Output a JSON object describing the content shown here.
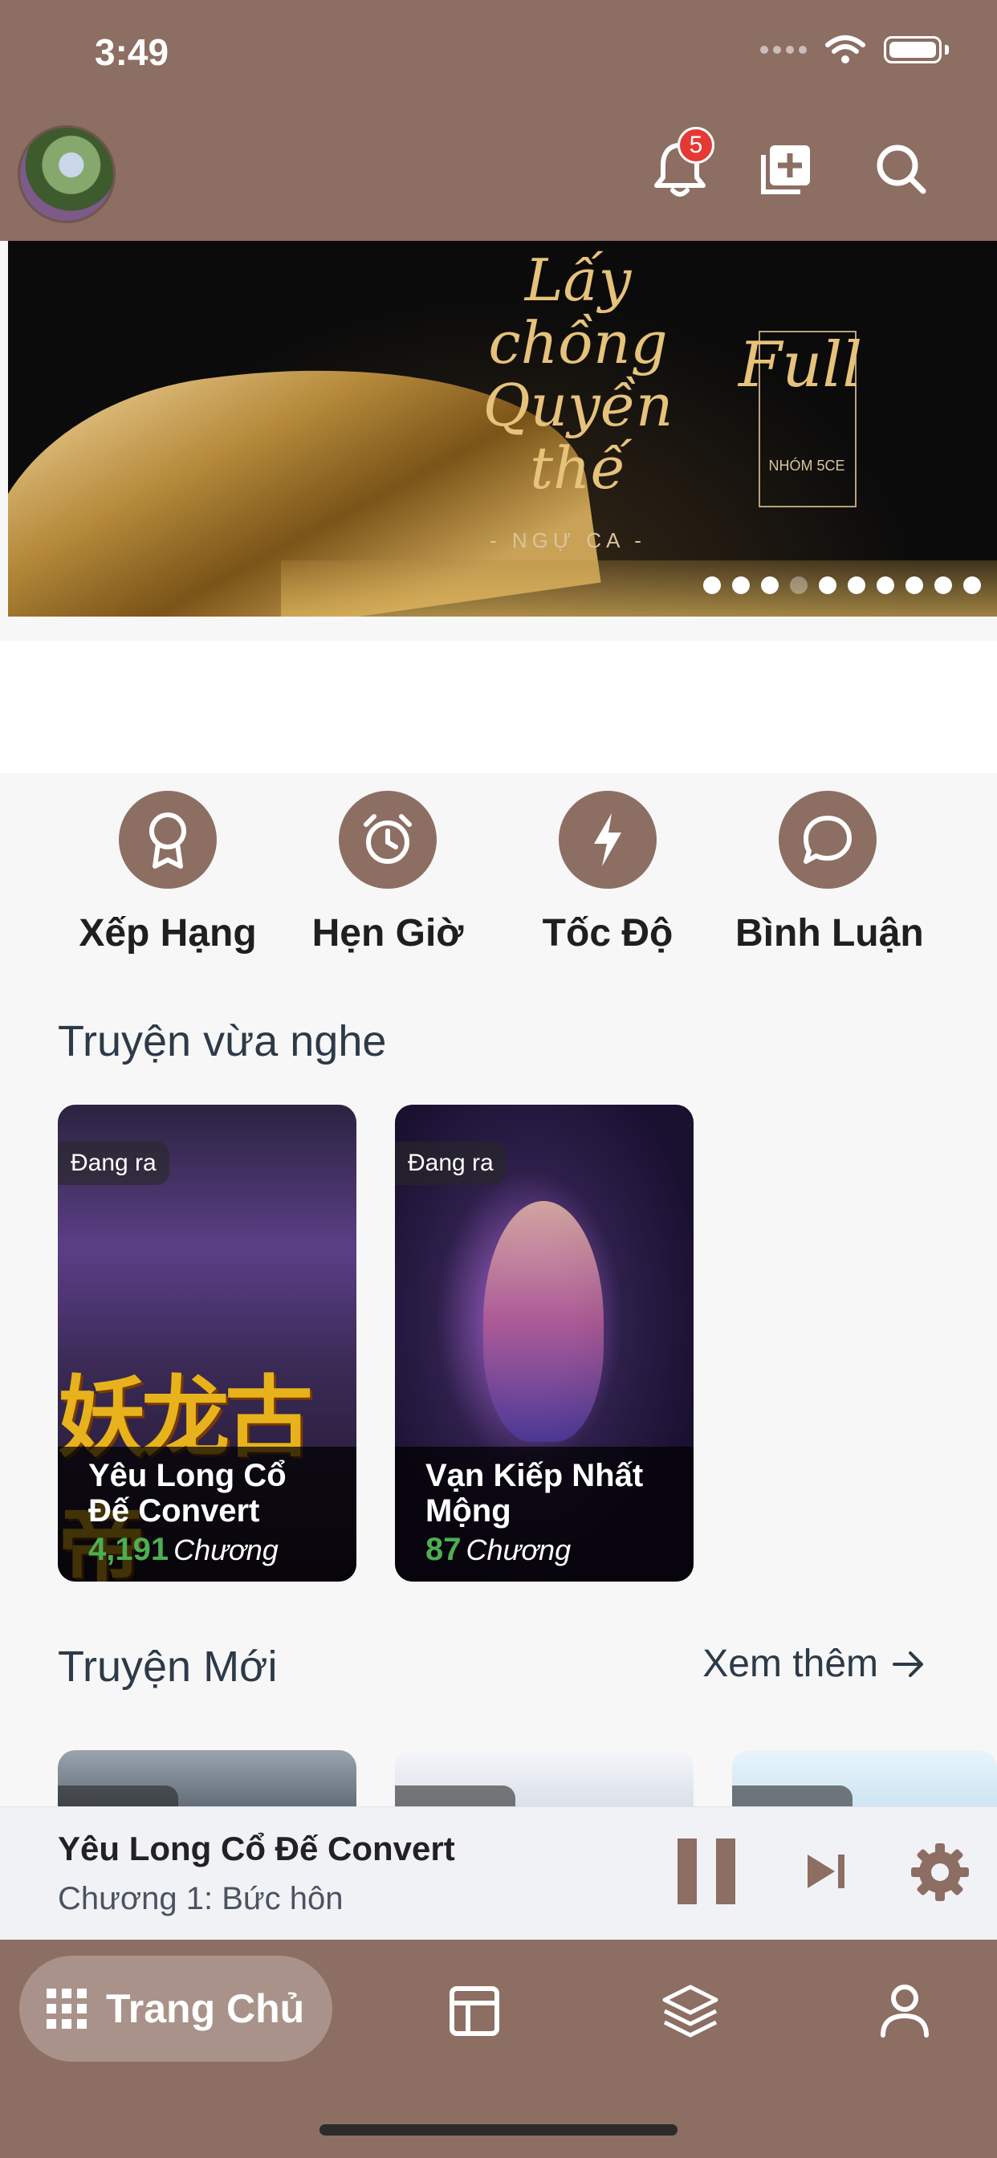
{
  "status_bar": {
    "time": "3:49"
  },
  "header": {
    "notification_count": "5"
  },
  "banner": {
    "title": "Lấy chồng Quyền thế",
    "author": "- NGỰ CA -",
    "badge": "Full",
    "group": "NHÓM 5CE",
    "page_count": 10,
    "active_page": 4
  },
  "quick_actions": [
    {
      "label": "Xếp Hạng",
      "icon": "award-icon"
    },
    {
      "label": "Hẹn Giờ",
      "icon": "alarm-clock-icon"
    },
    {
      "label": "Tốc Độ",
      "icon": "lightning-icon"
    },
    {
      "label": "Bình Luận",
      "icon": "chat-bubble-icon"
    }
  ],
  "recent": {
    "title": "Truyện vừa nghe",
    "items": [
      {
        "tag": "Đang ra",
        "name": "Yêu Long Cổ Đế Convert",
        "count": "4,191",
        "unit": "Chương"
      },
      {
        "tag": "Đang ra",
        "name": "Vạn Kiếp Nhất Mộng",
        "count": "87",
        "unit": "Chương"
      }
    ]
  },
  "new_stories": {
    "title": "Truyện Mới",
    "see_more": "Xem thêm"
  },
  "player": {
    "title": "Yêu Long Cổ Đế Convert",
    "chapter": "Chương 1: Bức hôn"
  },
  "bottom_nav": {
    "home_label": "Trang Chủ"
  },
  "colors": {
    "brand": "#8d6e63",
    "count_green": "#4caf50",
    "badge_red": "#e53935"
  }
}
